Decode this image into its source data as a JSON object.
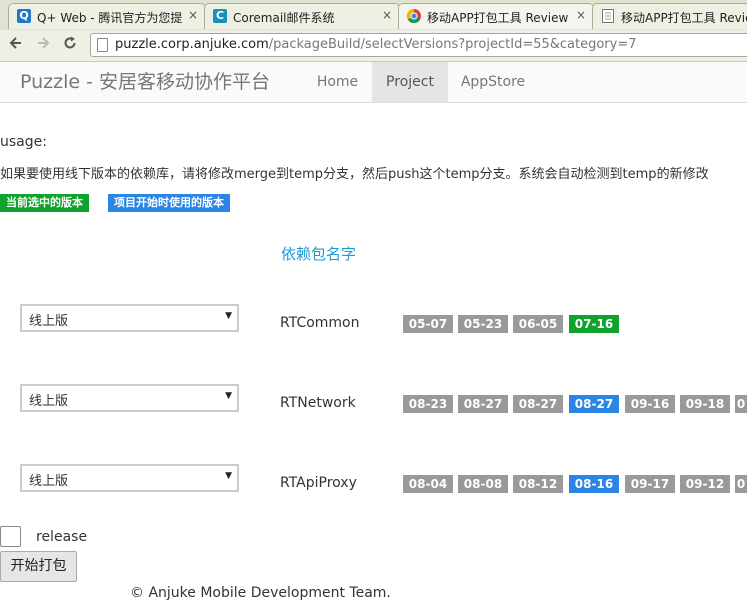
{
  "browser": {
    "tabs": [
      {
        "title": "Q+ Web - 腾讯官方为您提",
        "icon": "Q",
        "icon_color": "#1f78c8",
        "close": "×"
      },
      {
        "title": "Coremail邮件系统",
        "icon": "C",
        "icon_color": "#1a8fc2",
        "close": "×"
      },
      {
        "title": "移动APP打包工具 Review",
        "icon": "chrome-icon",
        "close": "×"
      },
      {
        "title": "移动APP打包工具 Review",
        "icon": "page-icon",
        "close": ""
      }
    ],
    "url": {
      "host": "puzzle.corp.anjuke.com",
      "path": "/packageBuild/selectVersions?projectId=55&category=7"
    }
  },
  "navbar": {
    "brand": "Puzzle - 安居客移动协作平台",
    "items": [
      {
        "label": "Home",
        "active": false
      },
      {
        "label": "Project",
        "active": true
      },
      {
        "label": "AppStore",
        "active": false
      }
    ]
  },
  "content": {
    "usage_label": "usage:",
    "instructions": "如果要使用线下版本的依赖库，请将修改merge到temp分支，然后push这个temp分支。系统会自动检测到temp的新修改",
    "legend": {
      "current": {
        "label": "当前选中的版本",
        "color": "#0fa32b"
      },
      "initial": {
        "label": "项目开始时使用的版本",
        "color": "#2b85e4"
      }
    },
    "column_header": "依赖包名字",
    "packages": [
      {
        "select_value": "线上版",
        "name": "RTCommon",
        "versions": [
          "05-07",
          "05-23",
          "06-05",
          "07-16"
        ],
        "states": [
          "",
          "",
          "",
          "current"
        ]
      },
      {
        "select_value": "线上版",
        "name": "RTNetwork",
        "versions": [
          "08-23",
          "08-27",
          "08-27",
          "08-27",
          "09-16",
          "09-18",
          "0"
        ],
        "states": [
          "",
          "",
          "",
          "initial",
          "",
          "",
          ""
        ]
      },
      {
        "select_value": "线上版",
        "name": "RTApiProxy",
        "versions": [
          "08-04",
          "08-08",
          "08-12",
          "08-16",
          "09-17",
          "09-12",
          "0"
        ],
        "states": [
          "",
          "",
          "",
          "initial",
          "",
          "",
          ""
        ]
      }
    ],
    "release_label": "release",
    "build_button": "开始打包",
    "footer": "© Anjuke Mobile Development Team."
  }
}
